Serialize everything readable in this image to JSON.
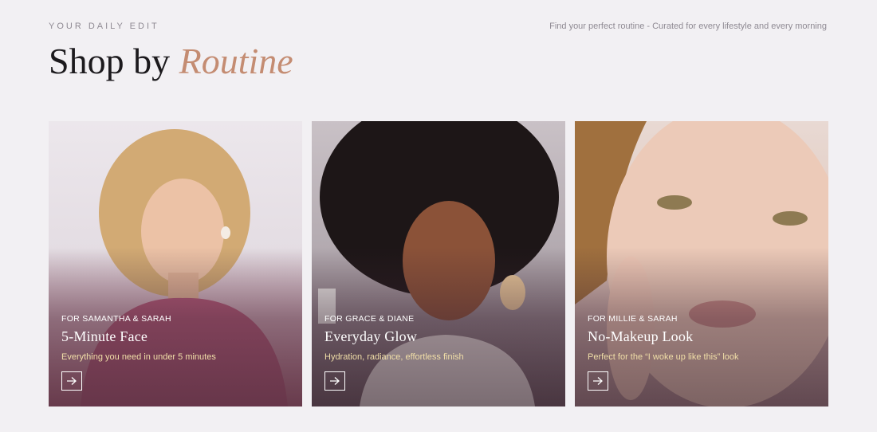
{
  "header": {
    "eyebrow": "YOUR DAILY EDIT",
    "tagline": "Find your perfect routine - Curated for every lifestyle and every morning",
    "title_main": "Shop by",
    "title_accent": "Routine"
  },
  "cards": [
    {
      "for": "FOR SAMANTHA & SARAH",
      "name": "5-Minute Face",
      "desc": "Everything you need in under 5 minutes"
    },
    {
      "for": "FOR GRACE & DIANE",
      "name": "Everyday Glow",
      "desc": "Hydration, radiance, effortless finish"
    },
    {
      "for": "FOR MILLIE & SARAH",
      "name": "No-Makeup Look",
      "desc": "Perfect for the “I woke up like this” look"
    }
  ],
  "colors": {
    "accent": "#c48c72",
    "description_text": "#f1dfa8",
    "background": "#f2f0f3"
  },
  "icons": {
    "card_arrow": "arrow-right-icon"
  }
}
